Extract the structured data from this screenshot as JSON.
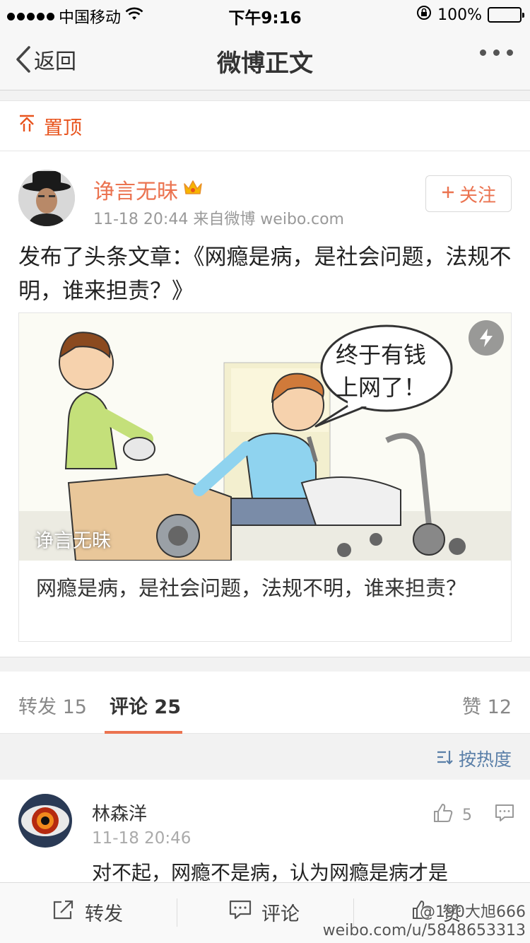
{
  "status_bar": {
    "carrier": "中国移动",
    "time": "下午9:16",
    "battery": "100%"
  },
  "nav": {
    "back_label": "返回",
    "title": "微博正文"
  },
  "pinned": {
    "label": "置顶"
  },
  "post": {
    "user_name": "诤言无昧",
    "meta": "11-18 20:44  来自微博 weibo.com",
    "follow_label": "关注",
    "text": "发布了头条文章：《网瘾是病，是社会问题，法规不明，谁来担责？》",
    "article": {
      "image_caption": "诤言无昧",
      "speech_bubble_line1": "终于有钱",
      "speech_bubble_line2": "上网了！",
      "title": "网瘾是病，是社会问题，法规不明，谁来担责？"
    }
  },
  "tabs": {
    "repost": {
      "label": "转发",
      "count": "15"
    },
    "comment": {
      "label": "评论",
      "count": "25"
    },
    "like": {
      "label": "赞",
      "count": "12"
    }
  },
  "sort": {
    "label": "按热度"
  },
  "comments": [
    {
      "name": "林森洋",
      "time": "11-18 20:46",
      "text": "对不起，网瘾不是病，认为网瘾是病才是",
      "likes": "5"
    }
  ],
  "toolbar": {
    "repost": "转发",
    "comment": "评论",
    "like": "赞"
  },
  "watermark": {
    "line1": "@190大旭666",
    "line2": "weibo.com/u/5848653313"
  },
  "colors": {
    "accent": "#eb7350",
    "link_blue": "#5a7fa8"
  }
}
